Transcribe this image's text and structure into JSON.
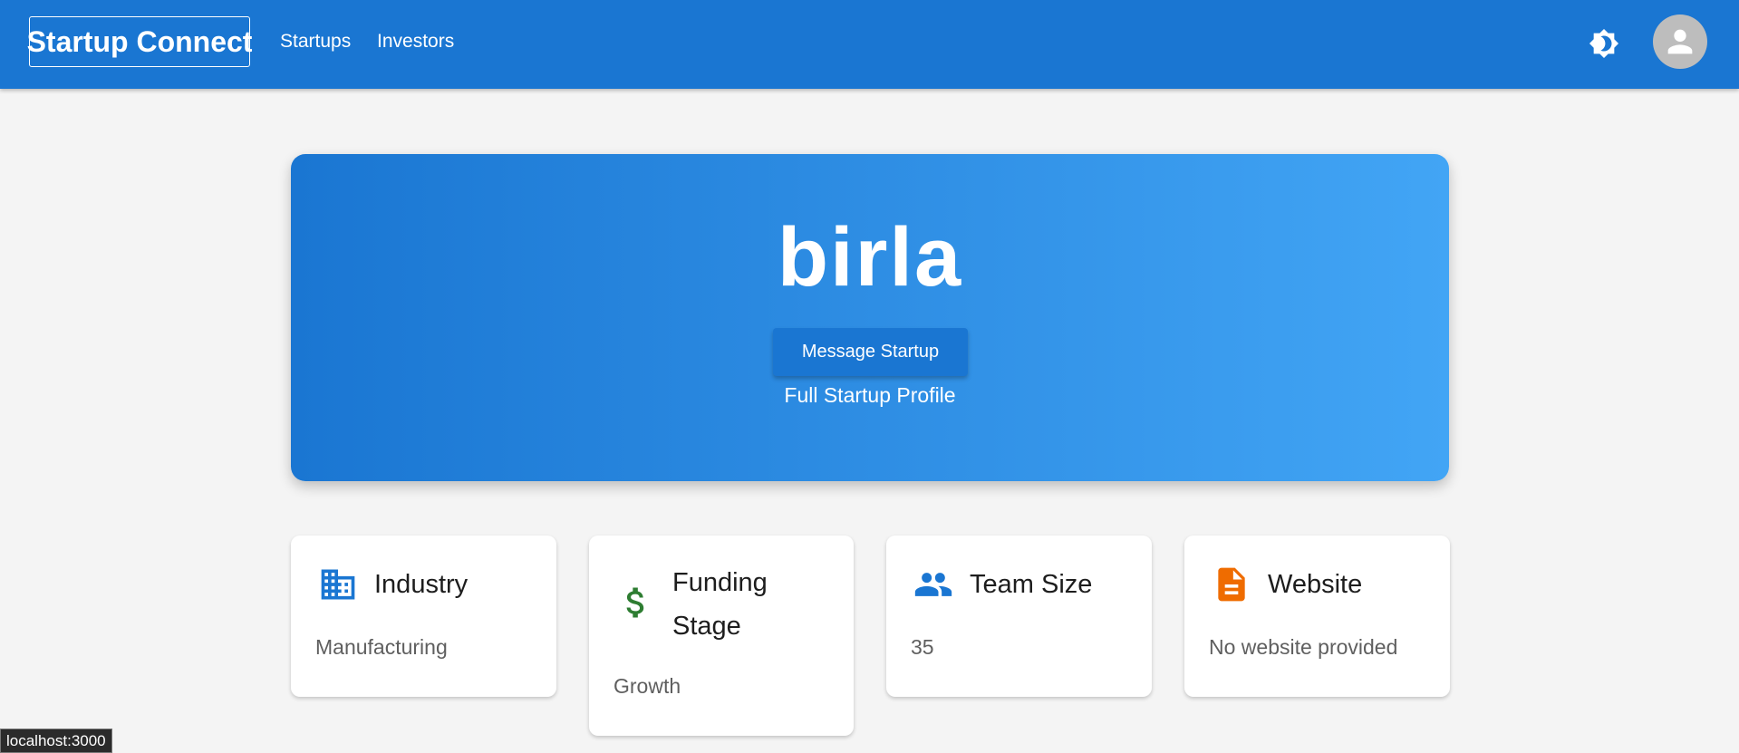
{
  "appbar": {
    "brand": "Startup Connect",
    "nav": [
      "Startups",
      "Investors"
    ],
    "theme_icon": "brightness-icon",
    "avatar_icon": "person-icon",
    "color": "#1a76d2"
  },
  "hero": {
    "title": "birla",
    "message_button": "Message Startup",
    "subtitle": "Full Startup Profile",
    "gradient": [
      "#1a76d2",
      "#42a5f5"
    ]
  },
  "cards": [
    {
      "title": "Industry",
      "value": "Manufacturing",
      "icon": "building-icon",
      "icon_color": "#1a76d2"
    },
    {
      "title": "Funding Stage",
      "value": "Growth",
      "icon": "dollar-icon",
      "icon_color": "#2e7d32"
    },
    {
      "title": "Team Size",
      "value": "35",
      "icon": "people-icon",
      "icon_color": "#1a76d2"
    },
    {
      "title": "Website",
      "value": "No website provided",
      "icon": "document-icon",
      "icon_color": "#ef6c00"
    }
  ],
  "status_bar": "localhost:3000"
}
